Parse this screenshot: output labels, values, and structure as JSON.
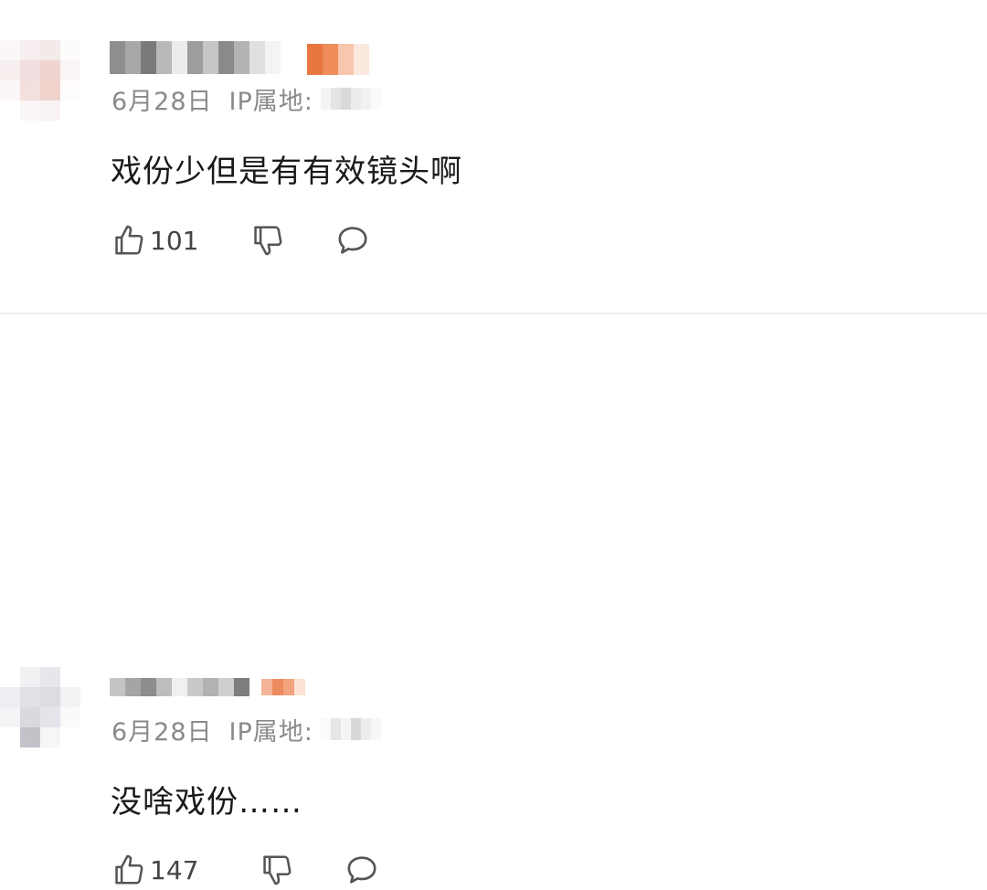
{
  "comments": [
    {
      "date": "6月28日",
      "ip_label": "IP属地:",
      "text": "戏份少但是有有效镜头啊",
      "likes": "101"
    },
    {
      "date": "6月28日",
      "ip_label": "IP属地:",
      "text": "没啥戏份……",
      "likes": "147"
    }
  ],
  "icons": {
    "like": "thumbs-up-icon",
    "dislike": "thumbs-down-icon",
    "reply": "comment-bubble-icon"
  },
  "colors": {
    "meta_text": "#8a8a8a",
    "content_text": "#1a1a1a",
    "badge_orange": "#e8773f",
    "divider": "#ececec"
  }
}
